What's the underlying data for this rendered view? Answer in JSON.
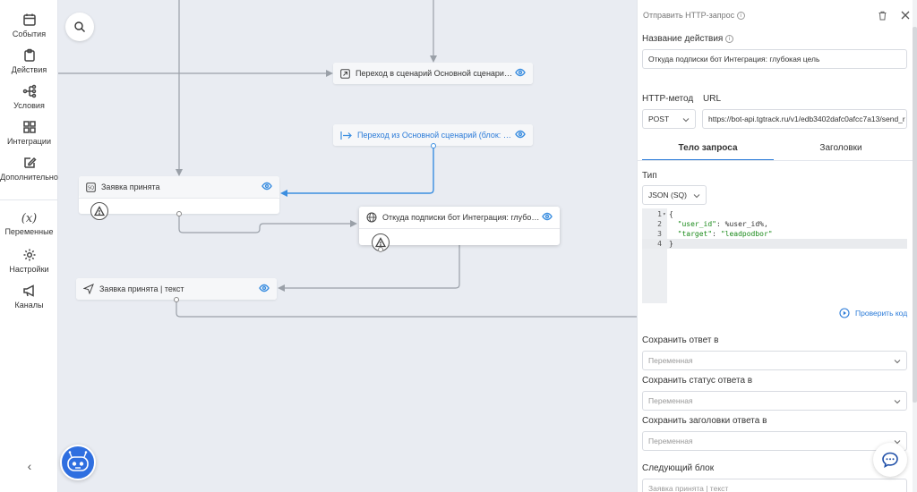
{
  "sidebar": {
    "items": [
      {
        "label": "События",
        "icon": "calendar-icon"
      },
      {
        "label": "Действия",
        "icon": "clipboard-icon"
      },
      {
        "label": "Условия",
        "icon": "branch-icon"
      },
      {
        "label": "Интеграции",
        "icon": "grid-icon"
      },
      {
        "label": "Дополнительно",
        "icon": "edit-icon"
      },
      {
        "label": "Переменные",
        "icon": "variable-icon"
      },
      {
        "label": "Настройки",
        "icon": "gear-icon"
      },
      {
        "label": "Каналы",
        "icon": "megaphone-icon"
      }
    ],
    "collapse": "‹"
  },
  "canvas": {
    "nodes": [
      {
        "id": "goto-main",
        "title": "Переход в сценарий Основной сценарий (бл..."
      },
      {
        "id": "from-main",
        "title": "Переход из Основной сценарий (блок: %Под..."
      },
      {
        "id": "request-accepted",
        "title": "Заявка принята"
      },
      {
        "id": "http-node",
        "title": "Откуда подписки бот Интеграция: глубокая ..."
      },
      {
        "id": "request-text",
        "title": "Заявка принята | текст"
      }
    ]
  },
  "panel": {
    "header_title": "Отправить HTTP-запрос",
    "action_name_label": "Название действия",
    "action_name_value": "Откуда подписки бот Интеграция: глубокая цель",
    "method_label": "HTTP-метод",
    "url_label": "URL",
    "method_value": "POST",
    "url_value": "https://bot-api.tgtrack.ru/v1/edb3402dafc0afcc7a13/send_r",
    "tabs": [
      "Тело запроса",
      "Заголовки"
    ],
    "type_label": "Тип",
    "type_value": "JSON (SQ)",
    "code_lines": [
      {
        "n": "1",
        "text": "{"
      },
      {
        "n": "2",
        "key": "\"user_id\"",
        "rest": ": %user_id%,"
      },
      {
        "n": "3",
        "key": "\"target\"",
        "rest": ": ",
        "str": "\"leadpodbor\""
      },
      {
        "n": "4",
        "text": "}"
      }
    ],
    "check_code": "Проверить код",
    "save_response_label": "Сохранить ответ в",
    "save_status_label": "Сохранить статус ответа в",
    "save_headers_label": "Сохранить заголовки ответа в",
    "variable_placeholder": "Переменная",
    "next_block_label": "Следующий блок",
    "next_block_value": "Заявка принята | текст"
  },
  "colors": {
    "accent": "#2b7bd8",
    "canvas": "#e9ecf2",
    "bot": "#2f6fe0"
  }
}
